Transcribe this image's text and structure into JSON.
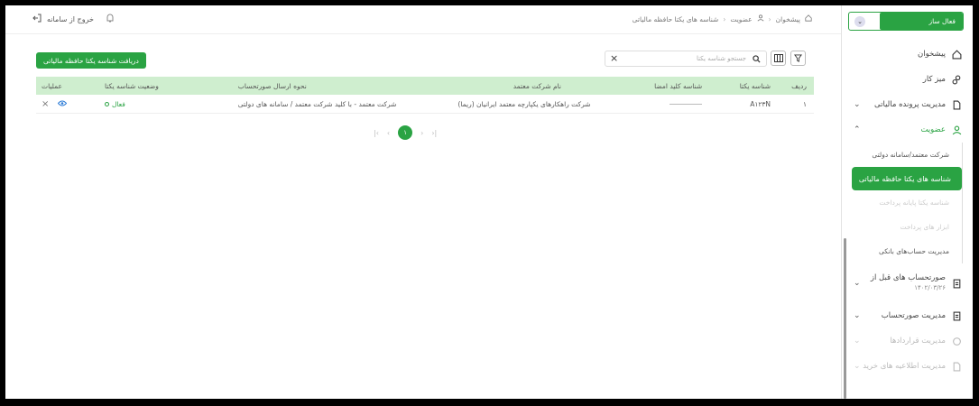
{
  "header": {
    "breadcrumb": [
      "پیشخوان",
      "عضویت",
      "شناسه های یکتا حافظه مالیاتی"
    ],
    "exit_label": "خروج از سامانه"
  },
  "toolbar": {
    "fetch_button": "دریافت شناسه یکتا حافظه مالیاتی",
    "search_placeholder": "جستجو شناسه یکتا"
  },
  "table": {
    "headers": {
      "row": "ردیف",
      "id": "شناسه یکتا",
      "key_id": "شناسه کلید امضا",
      "company": "نام شرکت معتمد",
      "send_method": "نحوه ارسال صورتحساب",
      "status": "وضعیت شناسه یکتا",
      "ops": "عملیات"
    },
    "rows": [
      {
        "row": "۱",
        "id": "A۱۲۳N",
        "company": "شرکت راهکارهای یکپارچه معتمد ایرانیان (ریما)",
        "send_method": "شرکت معتمد - با کلید شرکت معتمد / سامانه های دولتی",
        "status": "فعال"
      }
    ]
  },
  "pager": {
    "current": "۱"
  },
  "sidebar": {
    "company_label": "فعال ساز",
    "items": [
      {
        "label": "پیشخوان",
        "icon": "home-icon"
      },
      {
        "label": "میز کار",
        "icon": "people-icon"
      },
      {
        "label": "مدیریت پرونده مالیاتی",
        "icon": "file-icon"
      },
      {
        "label": "عضویت",
        "icon": "user-icon"
      }
    ],
    "sub_items": [
      "شرکت معتمد/سامانه دولتی",
      "شناسه های یکتا حافظه مالیاتی",
      "شناسه یکتا پایانه پرداخت",
      "ابزار های پرداخت",
      "مدیریت حساب‌های بانکی"
    ],
    "items2": [
      {
        "label": "صورتحساب های قبل از",
        "small": "۱۴۰۲/۰۳/۲۶",
        "icon": "invoice-icon"
      },
      {
        "label": "مدیریت صورتحساب",
        "icon": "invoice-icon"
      },
      {
        "label": "مدیریت قراردادها",
        "icon": "contract-icon"
      },
      {
        "label": "مدیریت اطلاعیه های خرید",
        "icon": "notice-icon"
      }
    ]
  },
  "colors": {
    "accent": "#2aa343",
    "header_bg": "#cfeecf"
  }
}
